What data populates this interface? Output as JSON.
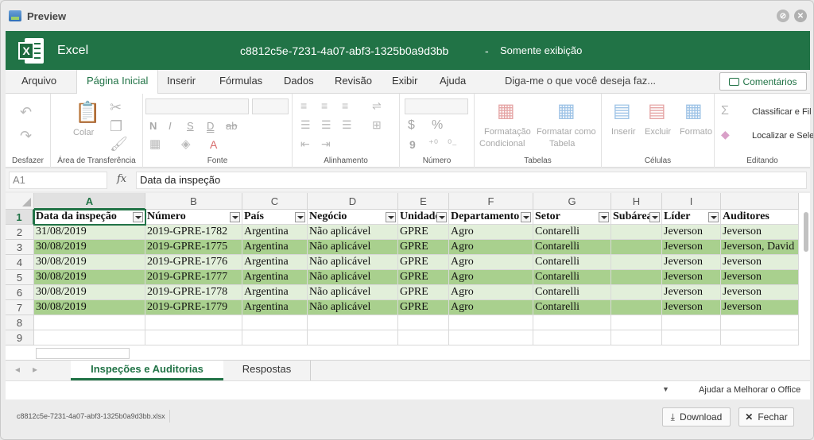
{
  "window": {
    "title": "Preview",
    "stop_icon": "stop-icon",
    "close_icon": "close-icon"
  },
  "excel": {
    "app_name": "Excel",
    "logo_letter": "X",
    "doc_name": "c8812c5e-7231-4a07-abf3-1325b0a9d3bb",
    "separator": "-",
    "mode": "Somente exibição",
    "accent": "#217346"
  },
  "menu": {
    "tabs": [
      "Arquivo",
      "Página Inicial",
      "Inserir",
      "Fórmulas",
      "Dados",
      "Revisão",
      "Exibir",
      "Ajuda"
    ],
    "active_tab": "Página Inicial",
    "tell_me": "Diga-me o que você deseja faz...",
    "comments": "Comentários"
  },
  "ribbon": {
    "undo": "Desfazer",
    "clipboard": {
      "paste": "Colar",
      "label": "Área de Transferência"
    },
    "font": {
      "label": "Fonte",
      "bold": "N",
      "italic": "I",
      "underline": "S",
      "double_underline": "D",
      "strike": "ab",
      "font_color": "A"
    },
    "alignment": {
      "label": "Alinhamento"
    },
    "number": {
      "label": "Número",
      "currency": "$",
      "percent": "%",
      "comma": "9"
    },
    "tables": {
      "label": "Tabelas",
      "cond_format_1": "Formatação",
      "cond_format_2": "Condicional",
      "format_table_1": "Formatar como",
      "format_table_2": "Tabela"
    },
    "cells": {
      "label": "Células",
      "insert": "Inserir",
      "delete": "Excluir",
      "format": "Formato"
    },
    "editing": {
      "label": "Editando",
      "sort": "Classificar e Fil",
      "find": "Localizar e Sele",
      "sum": "Σ"
    }
  },
  "formula_bar": {
    "cell_ref": "A1",
    "fx": "fx",
    "value": "Data da inspeção"
  },
  "sheet": {
    "columns": [
      "A",
      "B",
      "C",
      "D",
      "E",
      "F",
      "G",
      "H",
      "I",
      ""
    ],
    "row_numbers": [
      "1",
      "2",
      "3",
      "4",
      "5",
      "6",
      "7",
      "8",
      "9"
    ],
    "headers": [
      "Data da inspeção",
      "Número",
      "País",
      "Negócio",
      "Unidade",
      "Departamento",
      "Setor",
      "Subárea",
      "Líder",
      "Auditores"
    ],
    "rows": [
      [
        "31/08/2019",
        "2019-GPRE-1782",
        "Argentina",
        "Não aplicável",
        "GPRE",
        "Agro",
        "Contarelli",
        "",
        "Jeverson",
        "Jeverson"
      ],
      [
        "30/08/2019",
        "2019-GPRE-1775",
        "Argentina",
        "Não aplicável",
        "GPRE",
        "Agro",
        "Contarelli",
        "",
        "Jeverson",
        "Jeverson, David"
      ],
      [
        "30/08/2019",
        "2019-GPRE-1776",
        "Argentina",
        "Não aplicável",
        "GPRE",
        "Agro",
        "Contarelli",
        "",
        "Jeverson",
        "Jeverson"
      ],
      [
        "30/08/2019",
        "2019-GPRE-1777",
        "Argentina",
        "Não aplicável",
        "GPRE",
        "Agro",
        "Contarelli",
        "",
        "Jeverson",
        "Jeverson"
      ],
      [
        "30/08/2019",
        "2019-GPRE-1778",
        "Argentina",
        "Não aplicável",
        "GPRE",
        "Agro",
        "Contarelli",
        "",
        "Jeverson",
        "Jeverson"
      ],
      [
        "30/08/2019",
        "2019-GPRE-1779",
        "Argentina",
        "Não aplicável",
        "GPRE",
        "Agro",
        "Contarelli",
        "",
        "Jeverson",
        "Jeverson"
      ]
    ],
    "band_light": "#e2efda",
    "band_dark": "#a9d08e"
  },
  "sheet_tabs": {
    "tabs": [
      "Inspeções e Auditorias",
      "Respostas"
    ],
    "active": "Inspeções e Auditorias"
  },
  "status": {
    "help": "Ajudar a Melhorar o Office"
  },
  "footer": {
    "file_name": "c8812c5e-7231-4a07-abf3-1325b0a9d3bb.xlsx",
    "download": "Download",
    "close": "Fechar"
  }
}
